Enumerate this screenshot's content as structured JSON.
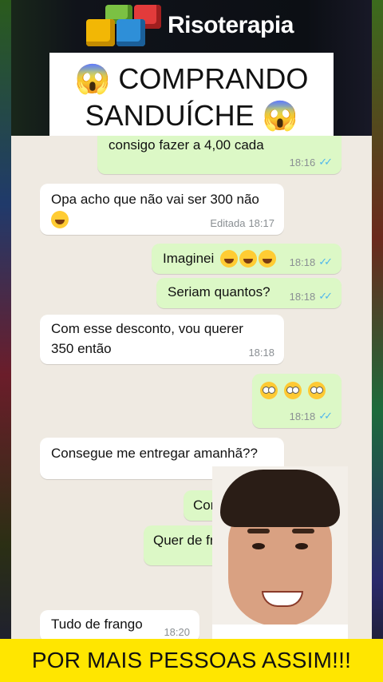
{
  "brand": {
    "name": "Risoterapia"
  },
  "title": {
    "line1": "😱 COMPRANDO",
    "line2": "SANDUÍCHE 😱"
  },
  "chat": {
    "messages": [
      {
        "dir": "out",
        "text": "consigo fazer a 4,00 cada",
        "time": "18:16",
        "ticks": "✓✓"
      },
      {
        "dir": "in",
        "text": "Opa acho que não vai ser 300 não",
        "emoji": "laughing-face",
        "edited": "Editada",
        "time": "18:17"
      },
      {
        "dir": "out",
        "text": "Imaginei",
        "emoji": "laughing-faces-x3",
        "time": "18:18",
        "ticks": "✓✓"
      },
      {
        "dir": "out",
        "text": "Seriam quantos?",
        "time": "18:18",
        "ticks": "✓✓"
      },
      {
        "dir": "in",
        "text": "Com esse desconto, vou querer",
        "text2": "350 então",
        "time": "18:18"
      },
      {
        "dir": "out",
        "emoji": "flushed-faces-x3",
        "time": "18:18",
        "ticks": "✓✓"
      },
      {
        "dir": "in",
        "text": "Consegue me entregar amanhã??"
      },
      {
        "dir": "out",
        "text": "Con"
      },
      {
        "dir": "out",
        "text": "Quer de fr"
      },
      {
        "dir": "in",
        "text": "Tudo de frango",
        "time": "18:20"
      }
    ]
  },
  "banner": {
    "text": "POR MAIS PESSOAS ASSIM!!!"
  }
}
